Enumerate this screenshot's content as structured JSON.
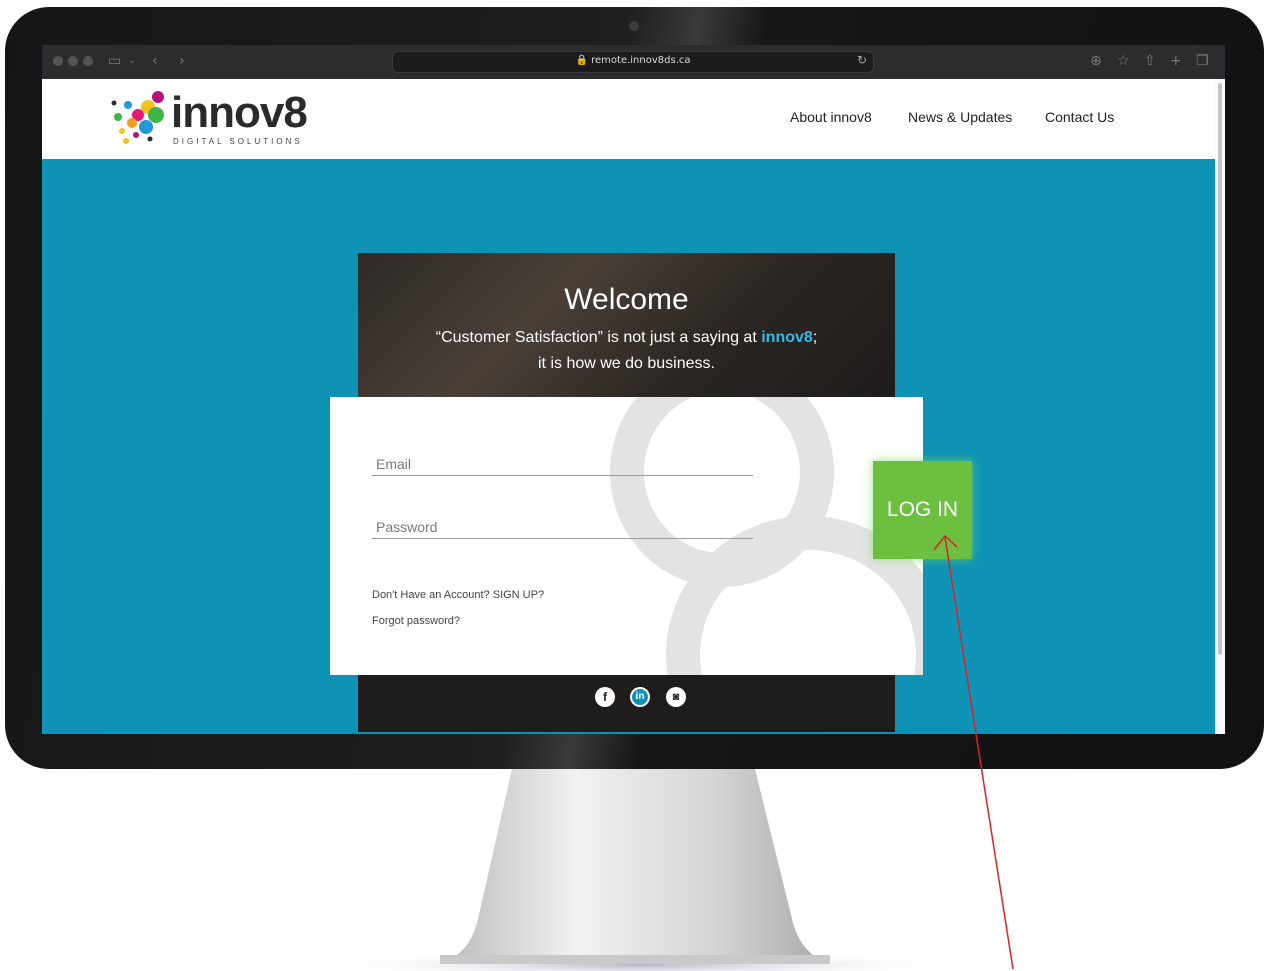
{
  "browser": {
    "url": "remote.innov8ds.ca"
  },
  "header": {
    "logo_text": "innov8",
    "logo_subtext": "DIGITAL SOLUTIONS",
    "nav": [
      "About innov8",
      "News & Updates",
      "Contact Us"
    ]
  },
  "hero": {
    "title": "Welcome",
    "line1_before": "“Customer Satisfaction” is not just a saying at ",
    "line1_brand": "innov8",
    "line1_after": ";",
    "line2": "it is how we do business."
  },
  "login_form": {
    "email_placeholder": "Email",
    "password_placeholder": "Password",
    "login_label": "LOG IN",
    "signup_link": "Don't Have an Account? SIGN UP?",
    "forgot_link": "Forgot password?"
  },
  "social": [
    "facebook-icon",
    "linkedin-icon",
    "instagram-icon"
  ],
  "colors": {
    "page_background": "#0e93b6",
    "login_button": "#6cbf3f",
    "brand_accent": "#34b8e6",
    "annotation_arrow": "#d8232a"
  }
}
